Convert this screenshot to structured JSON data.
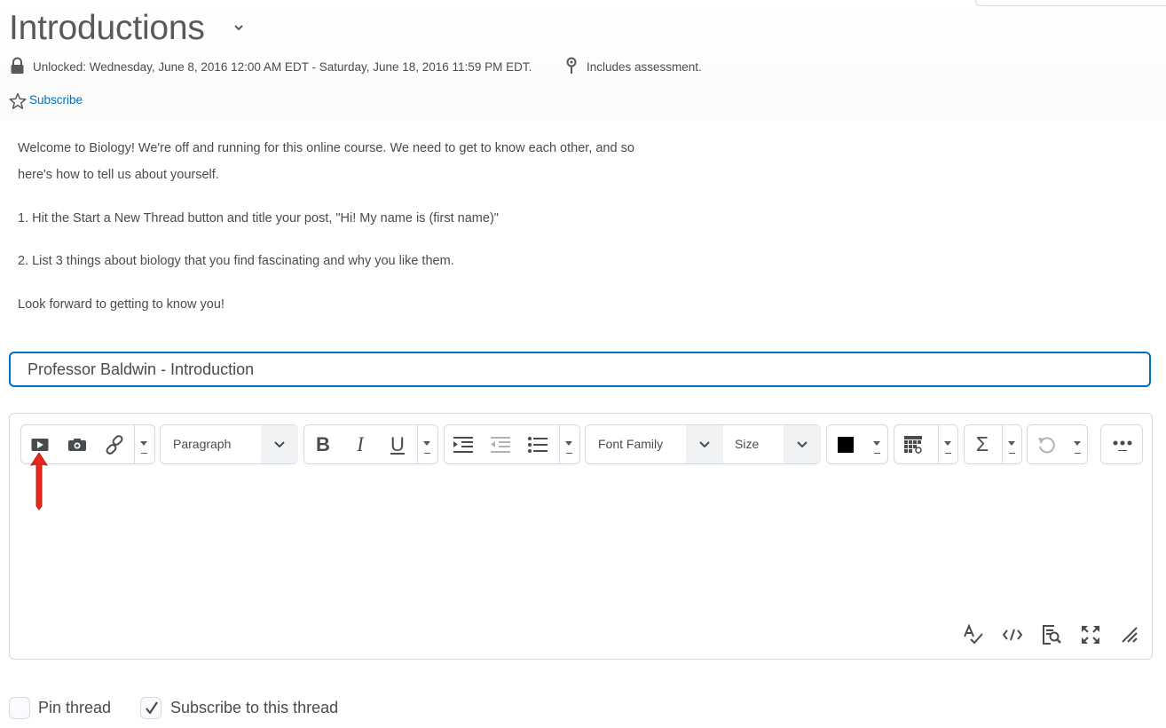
{
  "topic": {
    "title": "Introductions",
    "unlock_text": "Unlocked: Wednesday, June 8, 2016 12:00 AM EDT - Saturday, June 18, 2016 11:59 PM EDT.",
    "assessment_text": "Includes assessment.",
    "subscribe_label": "Subscribe"
  },
  "description": {
    "paragraphs": [
      "Welcome to Biology! We're off and running for this online course. We need to get to know each other, and so",
      "here's how to tell us about yourself.",
      "1. Hit the Start a New Thread button and title your post, \"Hi! My name is (first name)\"",
      "2. List 3 things about biology that you find fascinating and why you like them.",
      "Look forward to getting to know you!"
    ]
  },
  "thread_form": {
    "subject_value": "Professor Baldwin - Introduction",
    "toolbar": {
      "format_select": "Paragraph",
      "font_family_select": "Font Family",
      "font_size_select": "Size",
      "bold_glyph": "B",
      "italic_glyph": "I",
      "underline_glyph": "U",
      "equation_glyph": "Σ",
      "text_color": "#000000"
    },
    "options": {
      "pin_label": "Pin thread",
      "pin_checked": false,
      "subscribe_label": "Subscribe to this thread",
      "subscribe_checked": true
    }
  },
  "colors": {
    "link": "#006fbf",
    "focus_border": "#006fbf",
    "annotation_arrow": "#e5271c"
  },
  "icons": [
    "lock-icon",
    "pin-icon",
    "star-icon",
    "video-icon",
    "camera-icon",
    "link-icon",
    "indent-icon",
    "outdent-icon",
    "bullet-list-icon",
    "table-icon",
    "undo-icon",
    "more-icon",
    "spellcheck-icon",
    "code-icon",
    "preview-icon",
    "fullscreen-icon",
    "resize-icon",
    "checkmark-icon"
  ]
}
